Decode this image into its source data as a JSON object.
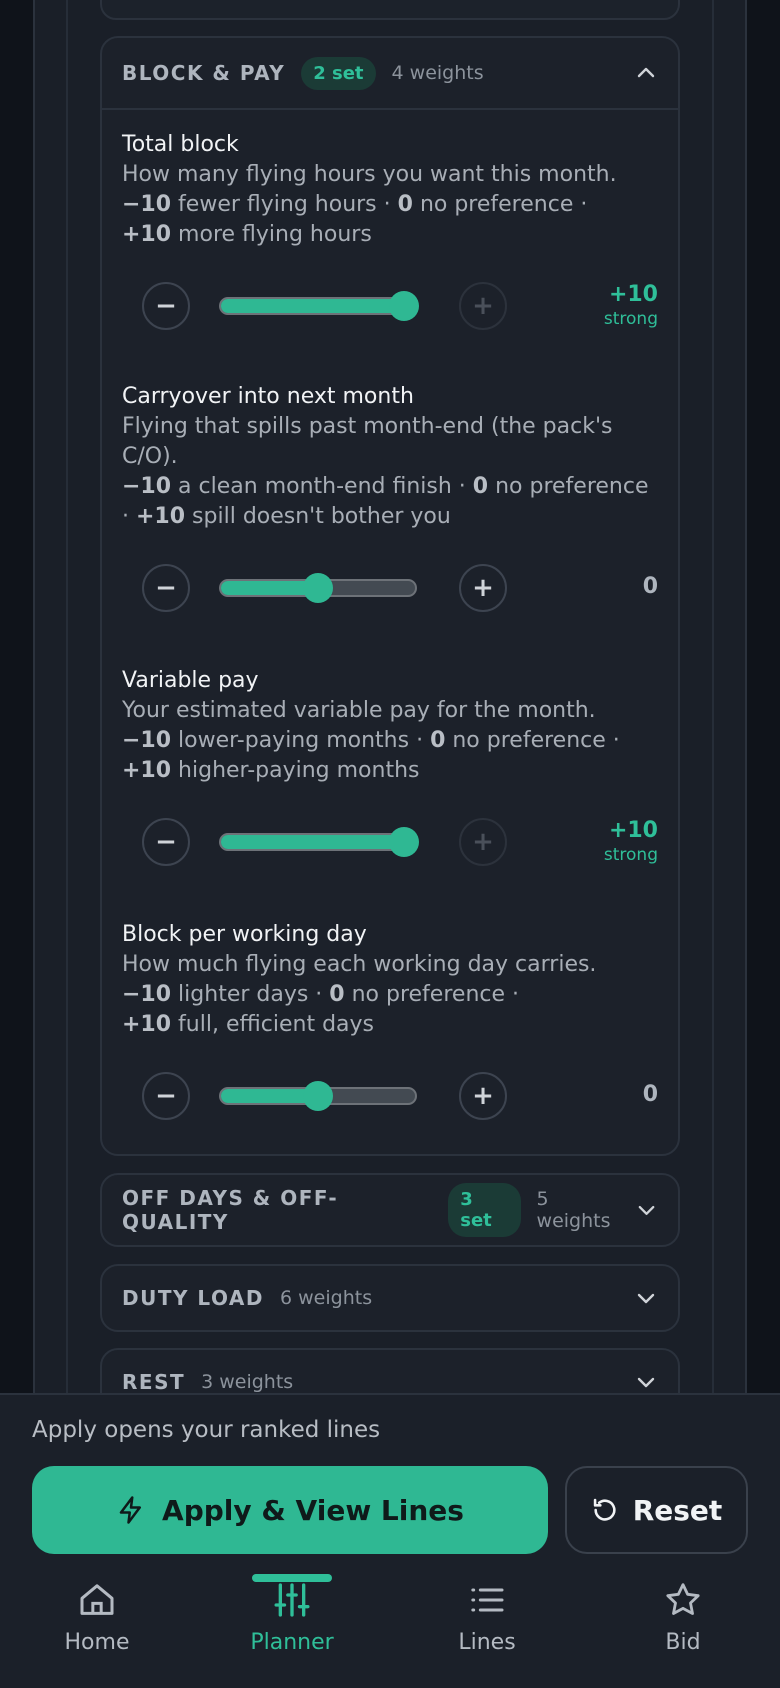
{
  "sections": {
    "block_pay": {
      "title": "BLOCK & PAY",
      "set_badge": "2 set",
      "weights": "4 weights"
    },
    "off_days": {
      "title": "OFF DAYS & OFF-QUALITY",
      "set_badge": "3 set",
      "weights": "5 weights"
    },
    "duty_load": {
      "title": "DUTY LOAD",
      "weights": "6 weights"
    },
    "rest": {
      "title": "REST",
      "weights": "3 weights"
    }
  },
  "prefs": [
    {
      "title": "Total block",
      "desc": "How many flying hours you want this month.",
      "neg": "−10",
      "neg_text": " fewer flying hours · ",
      "zero": "0",
      "zero_text": " no preference · ",
      "pos": "+10",
      "pos_text": " more flying hours",
      "value": "+10",
      "strength": "strong",
      "level": 1.0
    },
    {
      "title": "Carryover into next month",
      "desc": "Flying that spills past month-end (the pack's C/O).",
      "neg": "−10",
      "neg_text": " a clean month-end finish · ",
      "zero": "0",
      "zero_text": " no preference · ",
      "pos": "+10",
      "pos_text": " spill doesn't bother you",
      "value": "0",
      "strength": "",
      "level": 0.5
    },
    {
      "title": "Variable pay",
      "desc": "Your estimated variable pay for the month.",
      "neg": "−10",
      "neg_text": " lower-paying months · ",
      "zero": "0",
      "zero_text": " no preference · ",
      "pos": "+10",
      "pos_text": " higher-paying months",
      "value": "+10",
      "strength": "strong",
      "level": 1.0
    },
    {
      "title": "Block per working day",
      "desc": "How much flying each working day carries.",
      "neg": "−10",
      "neg_text": " lighter days · ",
      "zero": "0",
      "zero_text": " no preference · ",
      "pos": "+10",
      "pos_text": " full, efficient days",
      "value": "0",
      "strength": "",
      "level": 0.5
    }
  ],
  "controls": {
    "minus": "−",
    "plus": "+"
  },
  "footer": {
    "note": "Apply opens your ranked lines",
    "apply_label": "Apply & View Lines",
    "reset_label": "Reset"
  },
  "nav": {
    "home": "Home",
    "planner": "Planner",
    "lines": "Lines",
    "bid": "Bid"
  },
  "colors": {
    "accent": "#2fb893",
    "background": "#1a1f28"
  }
}
